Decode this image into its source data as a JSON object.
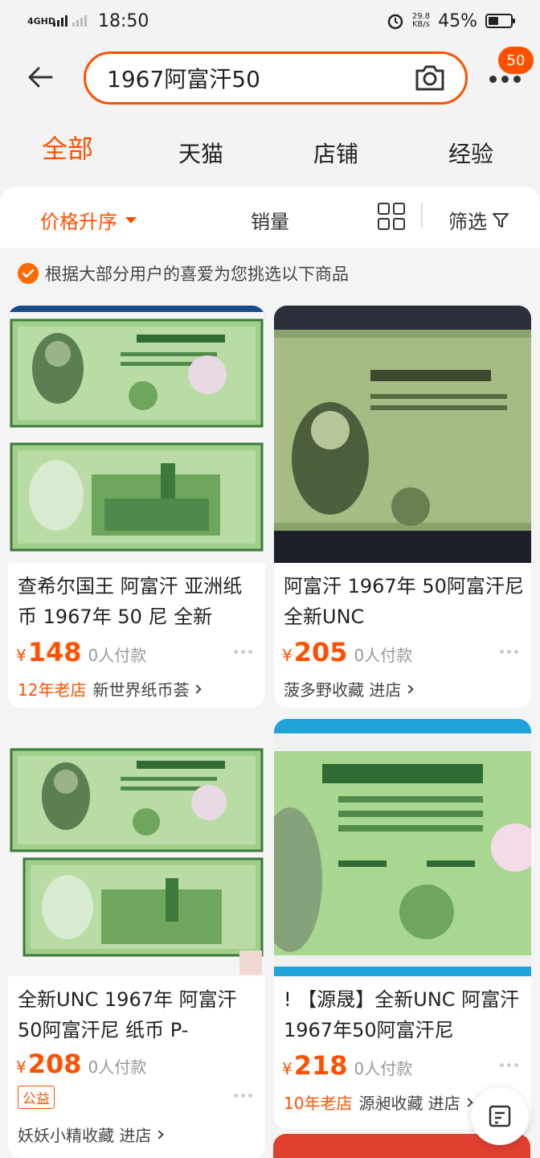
{
  "status_bar": {
    "network": "4GHD",
    "time": "18:50",
    "speed_value": "29.8",
    "speed_unit": "KB/s",
    "battery": "45%",
    "battery_level": 0.45
  },
  "search": {
    "query": "1967阿富汗50",
    "badge_count": "50"
  },
  "tabs": [
    {
      "label": "全部"
    },
    {
      "label": "天猫"
    },
    {
      "label": "店铺"
    },
    {
      "label": "经验"
    }
  ],
  "sort": {
    "price": "价格升序",
    "sales": "销量",
    "filter": "筛选"
  },
  "recommend_text": "根据大部分用户的喜爱为您挑选以下商品",
  "products": [
    {
      "title": "查希尔国王 阿富汗 亚洲纸币 1967年 50 尼 全新",
      "yen": "¥",
      "price": "148",
      "sold": "0人付款",
      "shop_tag": "12年老店",
      "shop": "新世界纸币荟"
    },
    {
      "title": "阿富汗 1967年 50阿富汗尼 全新UNC",
      "yen": "¥",
      "price": "205",
      "sold": "0人付款",
      "shop_tag": "",
      "shop": "菠多野收藏 进店"
    },
    {
      "title": "全新UNC 1967年 阿富汗50阿富汗尼 纸币 P-",
      "yen": "¥",
      "price": "208",
      "sold": "0人付款",
      "badge": "公益",
      "shop_tag": "",
      "shop": "妖妖小精收藏 进店"
    },
    {
      "title": "! 【源晟】全新UNC 阿富汗1967年50阿富汗尼",
      "yen": "¥",
      "price": "218",
      "sold": "0人付款",
      "shop_tag": "10年老店",
      "shop": "源昶收藏 进店"
    }
  ],
  "colors": {
    "accent": "#ff5000",
    "note_green": "#7fbf6a",
    "note_dark_green": "#2f6b34"
  }
}
